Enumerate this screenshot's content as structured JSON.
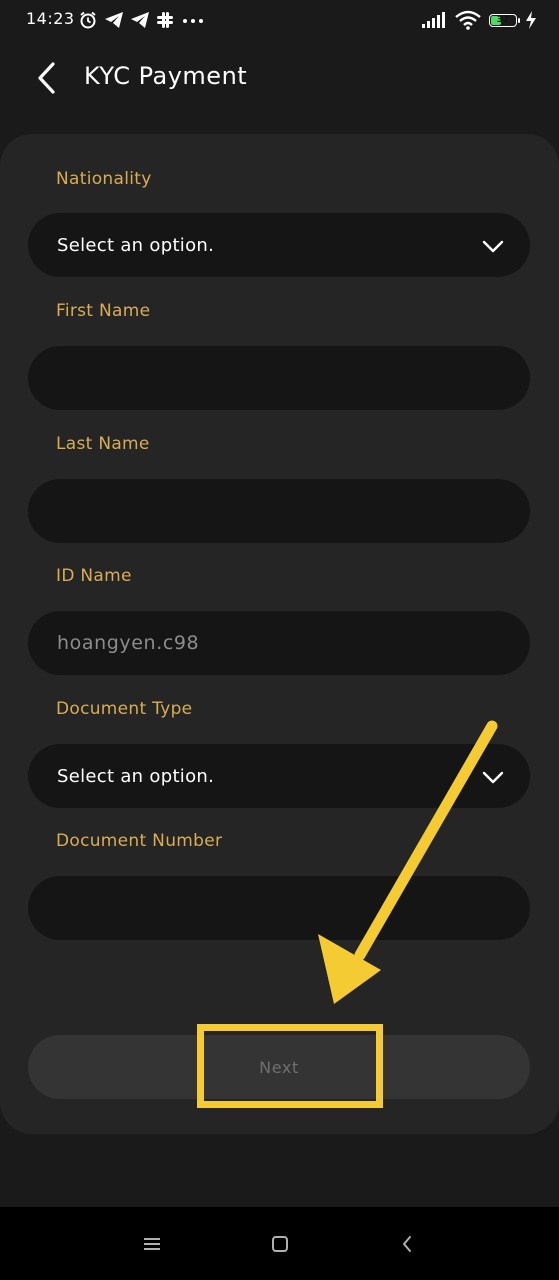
{
  "status_bar": {
    "time": "14:23",
    "battery_level": "37",
    "left_icons": [
      "alarm-icon",
      "telegram-icon",
      "telegram-icon",
      "slack-icon",
      "more-dots-icon"
    ],
    "right_icons": [
      "signal-icon",
      "wifi-icon",
      "battery-icon",
      "charging-icon"
    ],
    "battery_color": "#4cd964"
  },
  "header": {
    "title": "KYC Payment",
    "back_icon": "chevron-left-icon"
  },
  "form": {
    "nationality": {
      "label": "Nationality",
      "value": "Select an option."
    },
    "first_name": {
      "label": "First Name",
      "value": ""
    },
    "last_name": {
      "label": "Last Name",
      "value": ""
    },
    "id_name": {
      "label": "ID Name",
      "value": "hoangyen.c98"
    },
    "document_type": {
      "label": "Document Type",
      "value": "Select an option."
    },
    "document_number": {
      "label": "Document Number",
      "value": ""
    },
    "next_label": "Next"
  },
  "colors": {
    "label_gold": "#d8ad54",
    "annotation_yellow": "#f5cb33",
    "card_bg": "#252525",
    "input_bg": "#151515"
  },
  "nav_bar": {
    "icons": [
      "menu-icon",
      "home-square-icon",
      "back-triangle-icon"
    ]
  }
}
